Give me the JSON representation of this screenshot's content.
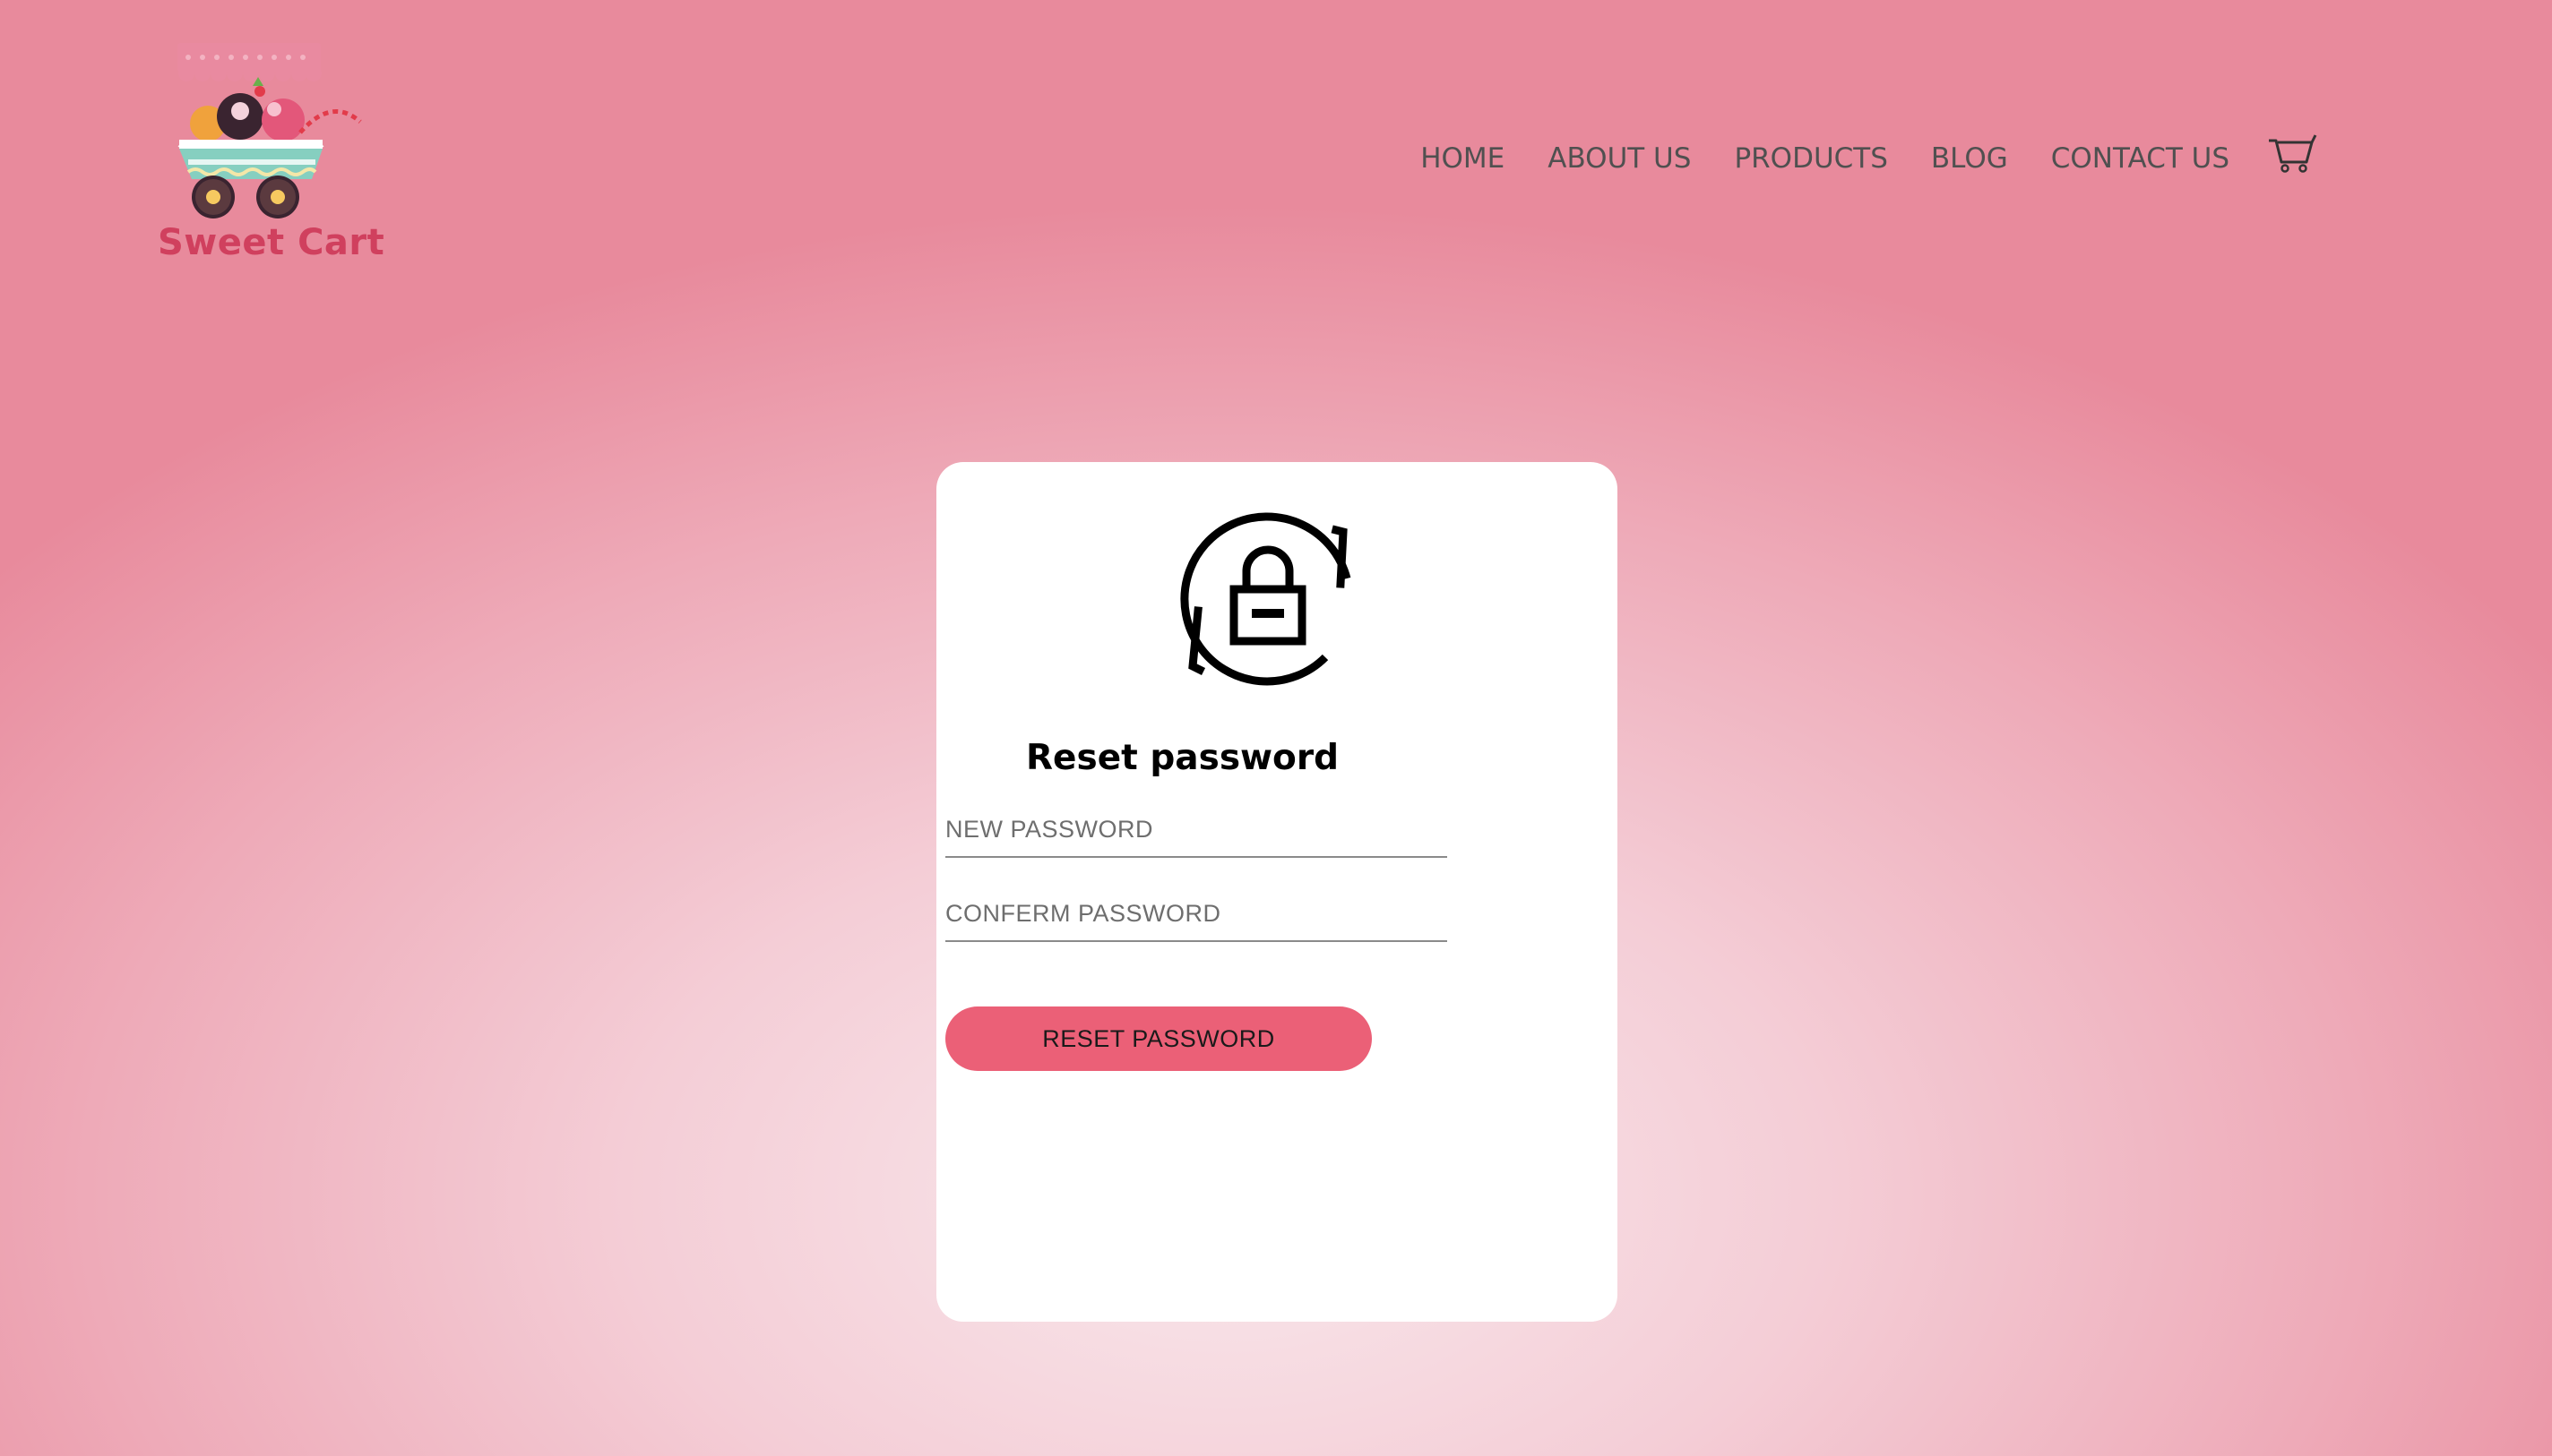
{
  "brand": {
    "name": "Sweet Cart",
    "logo_icon": "sweet-cart-logo-icon",
    "color": "#d0405e"
  },
  "nav": {
    "items": [
      {
        "label": "HOME"
      },
      {
        "label": "ABOUT US"
      },
      {
        "label": "PRODUCTS"
      },
      {
        "label": "BLOG"
      },
      {
        "label": "CONTACT US"
      }
    ],
    "cart_icon": "cart-icon"
  },
  "reset_form": {
    "icon": "lock-reset-icon",
    "title": "Reset password",
    "new_password_placeholder": "NEW PASSWORD",
    "confirm_password_placeholder": "CONFERM PASSWORD",
    "submit_label": "RESET PASSWORD"
  },
  "colors": {
    "accent": "#eb6077",
    "card": "#ffffff",
    "background_center": "#f9e8ec",
    "background_edge": "#e88a9c"
  }
}
